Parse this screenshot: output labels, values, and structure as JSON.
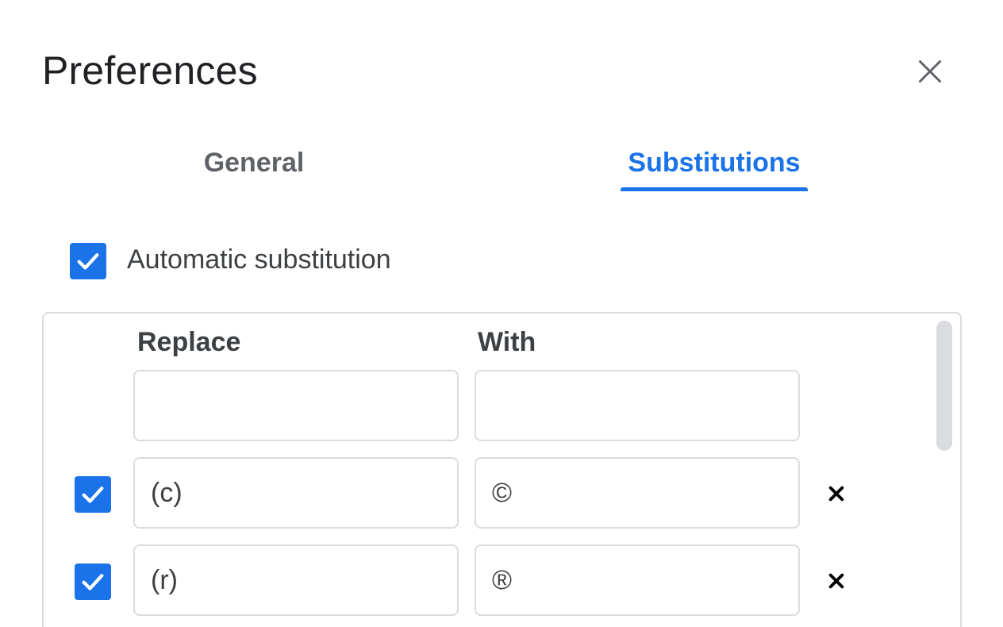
{
  "dialog": {
    "title": "Preferences"
  },
  "tabs": [
    {
      "label": "General",
      "active": false
    },
    {
      "label": "Substitutions",
      "active": true
    }
  ],
  "automatic_substitution": {
    "label": "Automatic substitution",
    "checked": true
  },
  "table": {
    "headers": {
      "replace": "Replace",
      "with": "With"
    },
    "new_entry": {
      "replace": "",
      "with": ""
    },
    "rows": [
      {
        "enabled": true,
        "replace": "(c)",
        "with": "©"
      },
      {
        "enabled": true,
        "replace": "(r)",
        "with": "®"
      }
    ]
  },
  "colors": {
    "accent": "#1a73e8",
    "border": "#dadce0",
    "text": "#202124"
  },
  "icons": {
    "close": "close-icon",
    "check": "checkmark-icon",
    "delete": "delete-x-icon"
  }
}
